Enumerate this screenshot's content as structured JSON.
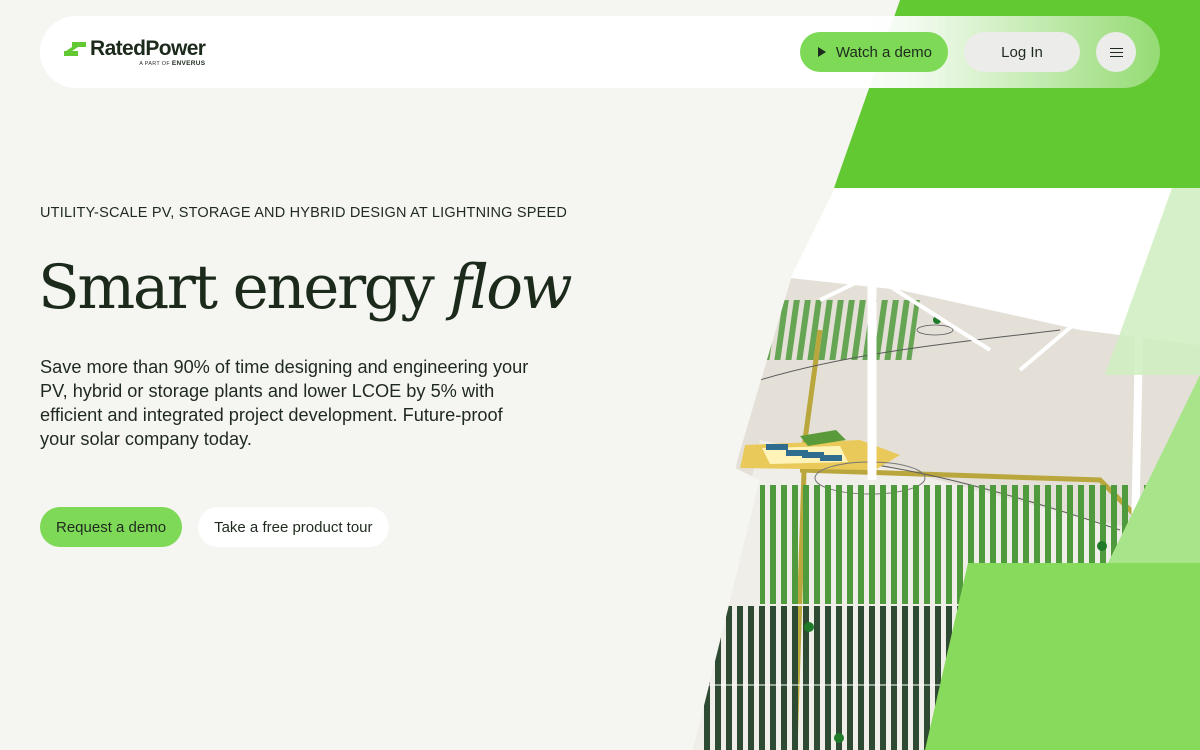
{
  "brand": {
    "name": "RatedPower",
    "tagline_prefix": "A PART OF",
    "tagline_company": "ENVERUS",
    "accent": "#7ed957",
    "accent_dark": "#62c933",
    "accent_light": "#a8e48a"
  },
  "nav": {
    "watch_demo": "Watch a demo",
    "login": "Log In",
    "menu_icon": "hamburger-icon",
    "play_icon": "play-icon"
  },
  "hero": {
    "eyebrow": "UTILITY-SCALE PV, STORAGE AND HYBRID DESIGN AT LIGHTNING SPEED",
    "headline_regular": "Smart energy ",
    "headline_italic": "flow",
    "lede": "Save more than 90% of time designing and engineering your PV, hybrid or storage plants and lower LCOE by 5% with efficient and integrated project development. Future-proof your solar company today.",
    "cta_primary": "Request a demo",
    "cta_secondary": "Take a free product tour"
  }
}
